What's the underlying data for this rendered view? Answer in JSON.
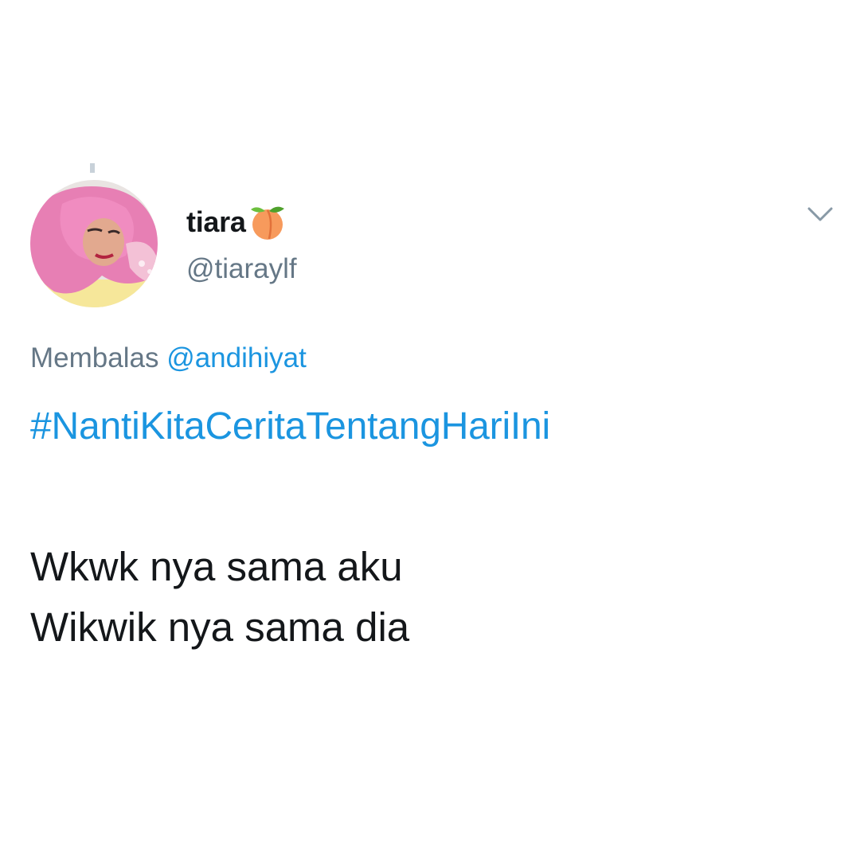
{
  "tweet": {
    "author": {
      "display_name": "tiara",
      "name_emoji": "peach-icon",
      "handle": "@tiaraylf"
    },
    "reply_prefix": "Membalas",
    "reply_to": "@andihiyat",
    "hashtag": "#NantiKitaCeritaTentangHariIni",
    "body_lines": [
      "Wkwk nya sama aku",
      "Wikwik nya sama dia"
    ],
    "menu_icon": "chevron-down-icon"
  },
  "colors": {
    "link": "#1b95e0",
    "secondary_text": "#657786",
    "primary_text": "#14171a",
    "background": "#ffffff"
  }
}
